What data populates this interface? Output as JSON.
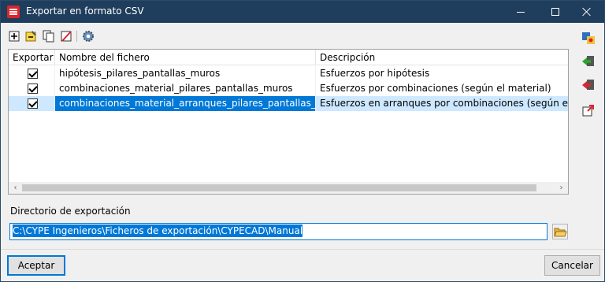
{
  "window": {
    "title": "Exportar en formato CSV",
    "icons": {
      "app": "cype-app-icon",
      "minimize": "minimize-icon",
      "maximize": "maximize-icon",
      "close": "close-icon"
    }
  },
  "toolbar": {
    "icons": [
      "add-row-icon",
      "edit-row-icon",
      "copy-row-icon",
      "delete-row-icon",
      "settings-gear-icon"
    ]
  },
  "table": {
    "columns": [
      "Exportar",
      "Nombre del fichero",
      "Descripción"
    ],
    "rows": [
      {
        "export": true,
        "file": "hipótesis_pilares_pantallas_muros",
        "description": "Esfuerzos por hipótesis",
        "selected": false
      },
      {
        "export": true,
        "file": "combinaciones_material_pilares_pantallas_muros",
        "description": "Esfuerzos por combinaciones (según el material)",
        "selected": false
      },
      {
        "export": true,
        "file": "combinaciones_material_arranques_pilares_pantallas_muros",
        "description": "Esfuerzos en arranques por combinaciones (según el mate",
        "selected": true
      }
    ],
    "scrollbar": {
      "left_arrow": "‹",
      "right_arrow": "›"
    }
  },
  "sidebar": {
    "icons": [
      "load-data-icon",
      "import-arrow-icon",
      "export-arrow-icon",
      "open-external-icon"
    ]
  },
  "export_dir": {
    "label": "Directorio de exportación",
    "value": "C:\\CYPE Ingenieros\\Ficheros de exportación\\CYPECAD\\Manual",
    "browse_icon": "open-folder-icon"
  },
  "buttons": {
    "accept": "Aceptar",
    "cancel": "Cancelar"
  },
  "colors": {
    "titlebar": "#1f3d5c",
    "selection": "#0078d7",
    "selected_row": "#cde8ff"
  }
}
